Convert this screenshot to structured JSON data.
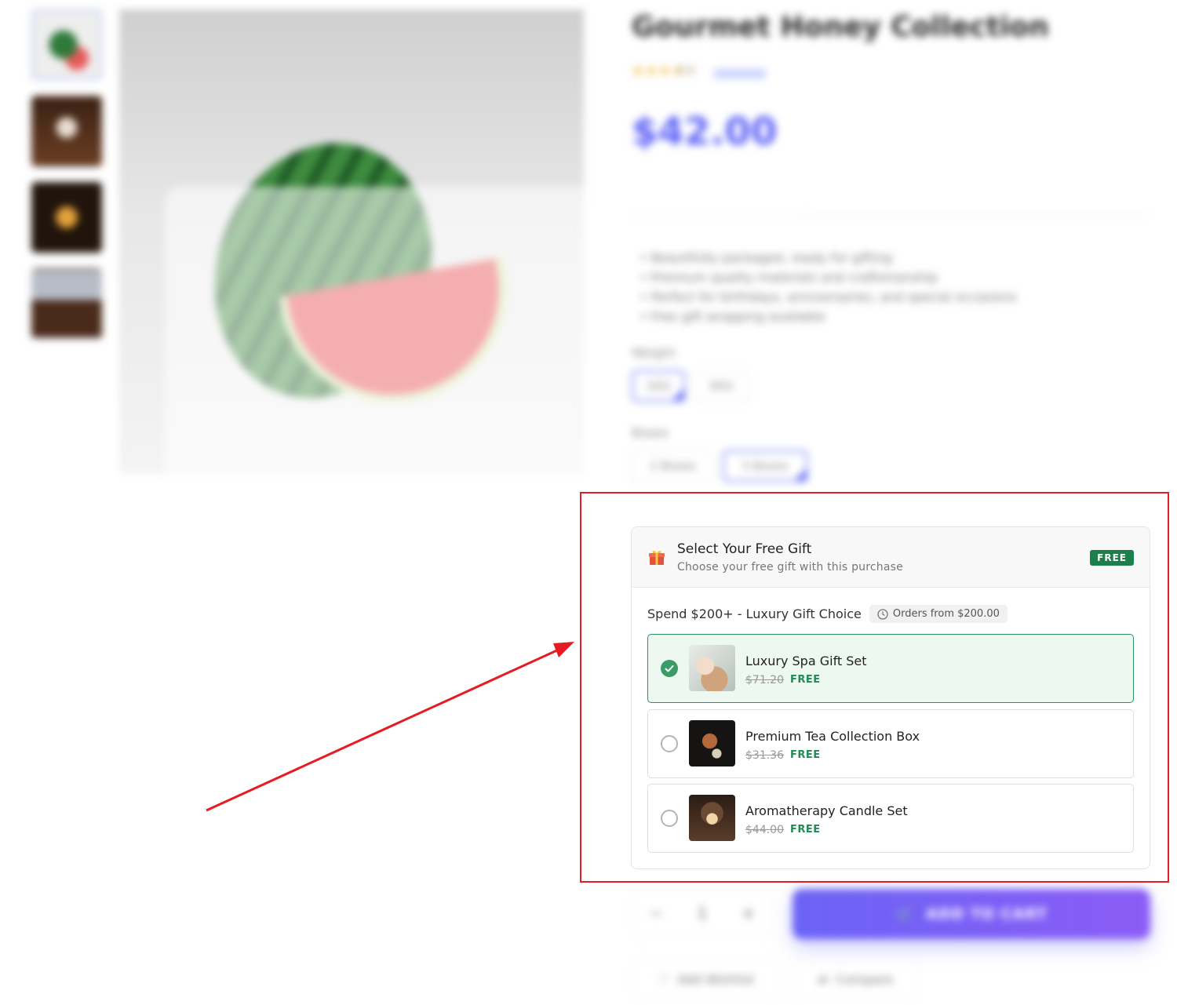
{
  "background": {
    "product_title": "Gourmet Honey Collection",
    "rating": {
      "stars": 4,
      "value": "4.0"
    },
    "price": "$42.00",
    "features": [
      "Beautifully packaged, ready for gifting",
      "Premium quality materials and craftsmanship",
      "Perfect for birthdays, anniversaries, and special occasions",
      "Free gift wrapping available"
    ],
    "weight": {
      "label": "Weight",
      "options": [
        "1KG",
        "5KG"
      ],
      "selected": "1KG"
    },
    "boxes": {
      "label": "Boxes",
      "options": [
        "2 Boxes",
        "5 Boxes"
      ],
      "selected": "5 Boxes"
    },
    "quantity": {
      "minus": "−",
      "value": "1",
      "plus": "+"
    },
    "add_to_cart": "ADD TO CART",
    "wishlist": "Add Wishlist",
    "compare": "Compare"
  },
  "gift": {
    "title": "Select Your Free Gift",
    "subtitle": "Choose your free gift with this purchase",
    "badge": "FREE",
    "tier_title": "Spend $200+ - Luxury Gift Choice",
    "tier_chip": "Orders from $200.00",
    "options": [
      {
        "name": "Luxury Spa Gift Set",
        "old_price": "$71.20",
        "free": "FREE",
        "selected": true
      },
      {
        "name": "Premium Tea Collection Box",
        "old_price": "$31.36",
        "free": "FREE",
        "selected": false
      },
      {
        "name": "Aromatherapy Candle Set",
        "old_price": "$44.00",
        "free": "FREE",
        "selected": false
      }
    ]
  },
  "colors": {
    "accent": "#5b5ff5",
    "annotation_red": "#e51c23",
    "free_green": "#1a7f4b",
    "selected_bg": "#edf8f1"
  },
  "icons": {
    "gift": "gift-icon",
    "clock": "clock-icon",
    "check": "check-icon",
    "cart": "cart-icon",
    "heart": "heart-icon",
    "compare": "compare-icon"
  }
}
